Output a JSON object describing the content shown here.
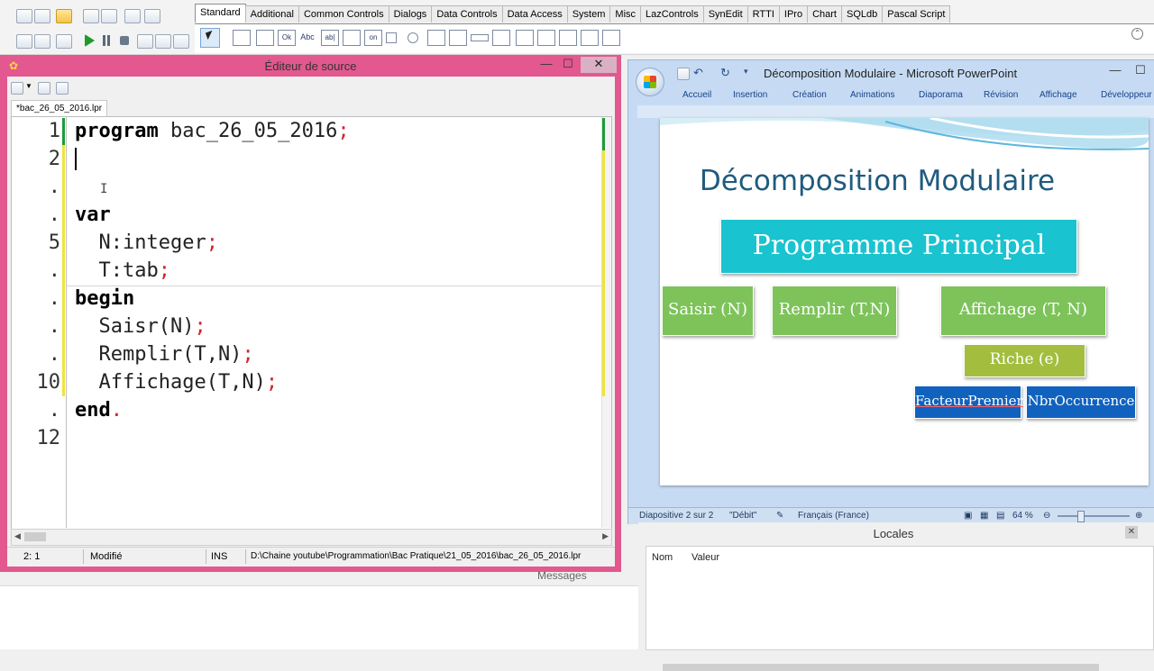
{
  "ide": {
    "palette_tabs": [
      "Standard",
      "Additional",
      "Common Controls",
      "Dialogs",
      "Data Controls",
      "Data Access",
      "System",
      "Misc",
      "LazControls",
      "SynEdit",
      "RTTI",
      "IPro",
      "Chart",
      "SQLdb",
      "Pascal Script"
    ],
    "active_tab": "Standard",
    "palette_icon_labels": [
      "Ok",
      "Abc",
      "ab|",
      "on"
    ]
  },
  "editor": {
    "title": "Éditeur de source",
    "tab_label": "*bac_26_05_2016.lpr",
    "line_numbers": [
      "1",
      "2",
      ".",
      ".",
      "5",
      ".",
      ".",
      ".",
      ".",
      "10",
      ".",
      "12"
    ],
    "code": [
      {
        "kw": "program",
        "rest": " bac_26_05_2016",
        "end": ";"
      },
      {
        "kw": "",
        "rest": "",
        "end": ""
      },
      {
        "kw": "",
        "rest": "",
        "end": ""
      },
      {
        "kw": "var",
        "rest": "",
        "end": ""
      },
      {
        "kw": "",
        "rest": "  N:integer",
        "end": ";"
      },
      {
        "kw": "",
        "rest": "  T:tab",
        "end": ";"
      },
      {
        "kw": "begin",
        "rest": "",
        "end": ""
      },
      {
        "kw": "",
        "rest": "  Saisr(N)",
        "end": ";"
      },
      {
        "kw": "",
        "rest": "  Remplir(T,N)",
        "end": ";"
      },
      {
        "kw": "",
        "rest": "  Affichage(T,N)",
        "end": ";"
      },
      {
        "kw": "end",
        "rest": "",
        "end": "."
      },
      {
        "kw": "",
        "rest": "",
        "end": ""
      }
    ],
    "status": {
      "cursor": "2: 1",
      "modified": "Modifié",
      "mode": "INS",
      "path": "D:\\Chaine youtube\\Programmation\\Bac Pratique\\21_05_2016\\bac_26_05_2016.lpr"
    }
  },
  "messages_label": "Messages",
  "powerpoint": {
    "title": "Décomposition Modulaire - Microsoft PowerPoint",
    "ribbon_tabs": [
      "Accueil",
      "Insertion",
      "Création",
      "Animations",
      "Diaporama",
      "Révision",
      "Affichage",
      "Développeur"
    ],
    "slide": {
      "title": "Décomposition Modulaire",
      "main_box": "Programme Principal",
      "modules": [
        "Saisir (N)",
        "Remplir (T,N)",
        "Affichage (T, N)"
      ],
      "sub_module": "Riche (e)",
      "sub_sub_modules": [
        "FacteurPremier",
        "NbrOccurrence"
      ]
    },
    "status": {
      "slide_info": "Diapositive 2 sur 2",
      "theme": "\"Débit\"",
      "language": "Français (France)",
      "zoom": "64 %"
    },
    "colors": {
      "main": "#19c3cf",
      "module": "#7dc35a",
      "sub": "#a3be3f",
      "leaf": "#1062be",
      "title": "#1f5b7e"
    }
  },
  "locales": {
    "title": "Locales",
    "columns": [
      "Nom",
      "Valeur"
    ]
  }
}
